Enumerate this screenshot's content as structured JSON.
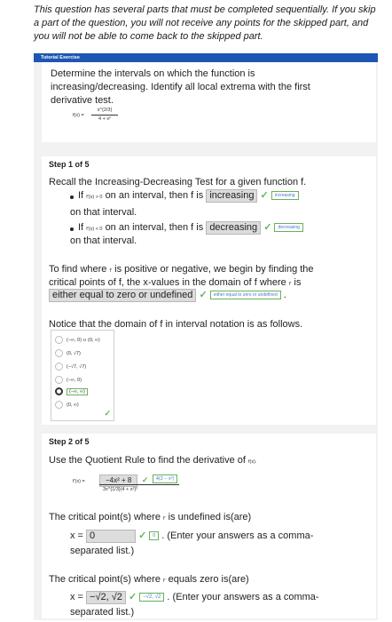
{
  "intro_text": "This question has several parts that must be completed sequentially. If you skip a part of the question, you will not receive any points for the skipped part, and you will not be able to come back to the skipped part.",
  "tutorial_label": "Tutorial Exercise",
  "problem": {
    "text": "Determine the intervals on which the function is increasing/decreasing. Identify all local extrema with the first derivative test.",
    "f_lhs": "f(x) =",
    "numerator": "x^{2/3}",
    "denominator": "4 + x²"
  },
  "step1": {
    "title": "Step 1 of 5",
    "intro": "Recall the Increasing-Decreasing Test for a given function f.",
    "bullet1_pre": "If",
    "bullet1_cond": "f′(x) > 0",
    "bullet1_mid": "on an interval, then f is",
    "bullet1_answer": "increasing",
    "bullet1_feedback": "increasing",
    "bullet1_post": "on that interval.",
    "bullet2_pre": "If",
    "bullet2_cond": "f′(x) < 0",
    "bullet2_mid": "on an interval, then f is",
    "bullet2_answer": "decreasing",
    "bullet2_feedback": "decreasing",
    "bullet2_post": "on that interval.",
    "para_line1_pre": "To find where",
    "fprime": "f′",
    "para_line1_post": "is positive or negative, we begin by finding the",
    "para_line2_pre": "critical points of f, the x-values in the domain of f where",
    "para_line2_post": "is",
    "critical_answer": "either equal to zero or undefined",
    "critical_feedback": "either equal to zero or undefined",
    "domain_text": "Notice that the domain of f in interval notation is as follows.",
    "options": [
      "(−∞, 0) ∪ (0, ∞)",
      "(0, √7)",
      "(−√7, √7)",
      "(−∞, 0)",
      "(−∞, ∞)",
      "(0, ∞)"
    ],
    "selected_index": 4
  },
  "step2": {
    "title": "Step 2 of 5",
    "intro_pre": "Use the Quotient Rule to find the derivative of",
    "intro_fx": "f(x).",
    "deriv_lhs": "f′(x) =",
    "deriv_num_answer": "−4x² + 8",
    "deriv_num_feedback": "4(2 − x²)",
    "deriv_den": "3x^{1/3}(4 + x²)²",
    "undefined_pre": "The critical point(s) where",
    "undefined_post": "is undefined is(are)",
    "x_eq": "x =",
    "undefined_answer": "0",
    "undefined_feedback": "0",
    "comma_note": ". (Enter your answers as a comma-",
    "separated": "separated list.)",
    "zero_pre": "The critical point(s) where",
    "zero_post": "equals zero is(are)",
    "zero_answer": "−√2, √2",
    "zero_feedback": "−√2, √2"
  },
  "colors": {
    "tutorial_bar": "#1e56b3",
    "check": "#5cb85c",
    "feedback_text": "#4a7ac8",
    "panel": "#f2f2f2"
  }
}
